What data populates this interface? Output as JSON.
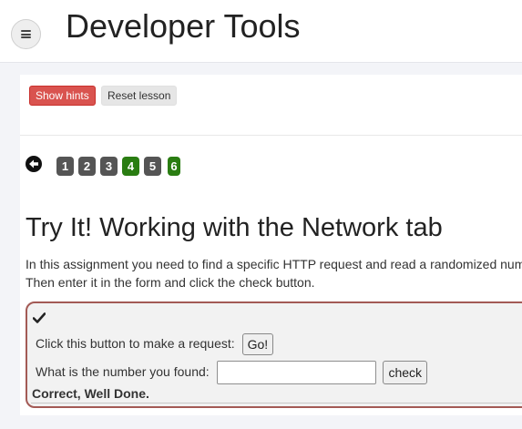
{
  "header": {
    "title": "Developer Tools",
    "menu_icon": "hamburger-menu-icon"
  },
  "toolbar": {
    "show_hints_label": "Show hints",
    "reset_lesson_label": "Reset lesson"
  },
  "pagination": {
    "back_icon": "arrow-left-circle-icon",
    "pages": [
      {
        "label": "1",
        "state": "default",
        "color": "#555555"
      },
      {
        "label": "2",
        "state": "default",
        "color": "#555555"
      },
      {
        "label": "3",
        "state": "default",
        "color": "#555555"
      },
      {
        "label": "4",
        "state": "solved",
        "color": "#2a7d12"
      },
      {
        "label": "5",
        "state": "default",
        "color": "#555555"
      },
      {
        "label": "6",
        "state": "solved-current",
        "color": "#2a7d12"
      }
    ]
  },
  "lesson": {
    "title": "Try It! Working with the Network tab",
    "description": "In this assignment you need to find a specific HTTP request and read a randomized number. Then enter it in the form and click the check button."
  },
  "assignment": {
    "status_icon": "checkmark-icon",
    "request_prompt": "Click this button to make a request:",
    "go_label": "Go!",
    "number_prompt": "What is the number you found:",
    "number_value": "",
    "check_label": "check",
    "result": "Correct, Well Done."
  }
}
